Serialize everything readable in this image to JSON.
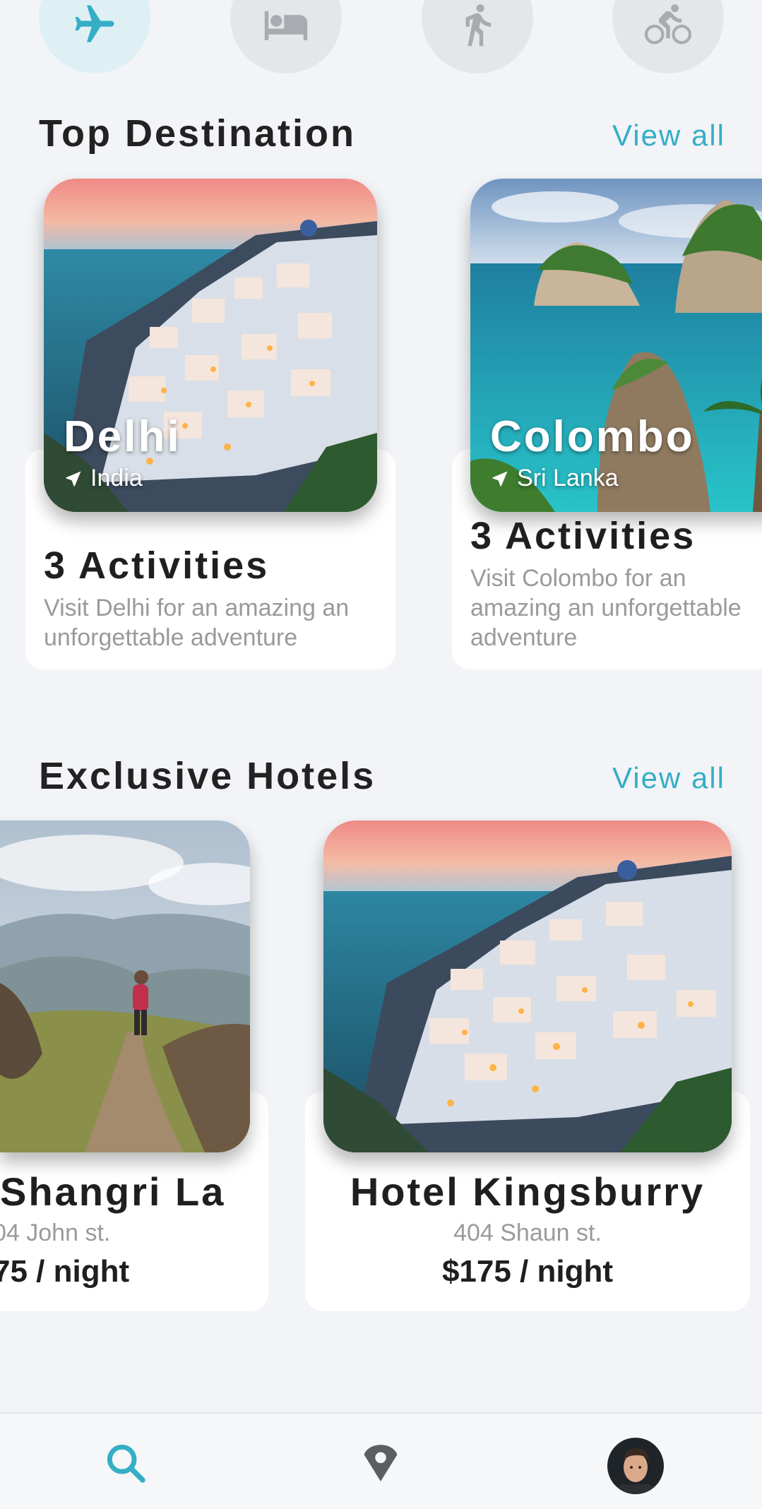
{
  "categories": [
    {
      "icon": "airplane-icon",
      "active": true
    },
    {
      "icon": "bed-icon",
      "active": false
    },
    {
      "icon": "walking-icon",
      "active": false
    },
    {
      "icon": "bicycle-icon",
      "active": false
    }
  ],
  "top_destination": {
    "title": "Top Destination",
    "view_all": "View all",
    "cards": [
      {
        "name": "Delhi",
        "country": "India",
        "activities": "3 Activities",
        "description": "Visit Delhi for an amazing an unforgettable adventure"
      },
      {
        "name": "Colombo",
        "country": "Sri Lanka",
        "activities": "3 Activities",
        "description": "Visit Colombo for an amazing an unforgettable adventure"
      }
    ]
  },
  "exclusive_hotels": {
    "title": "Exclusive Hotels",
    "view_all": "View all",
    "cards": [
      {
        "name": "Shangri La",
        "address": "04 John st.",
        "price": "75 / night"
      },
      {
        "name": "Hotel Kingsburry",
        "address": "404 Shaun st.",
        "price": "$175 / night"
      }
    ]
  },
  "bottom_nav": {
    "items": [
      {
        "icon": "search-icon",
        "active": true
      },
      {
        "icon": "map-pin-icon",
        "active": false
      },
      {
        "icon": "profile-avatar",
        "active": false
      }
    ]
  },
  "colors": {
    "accent": "#35aec6",
    "background": "#f2f4f7",
    "inactive_icon": "#a8acb0"
  }
}
